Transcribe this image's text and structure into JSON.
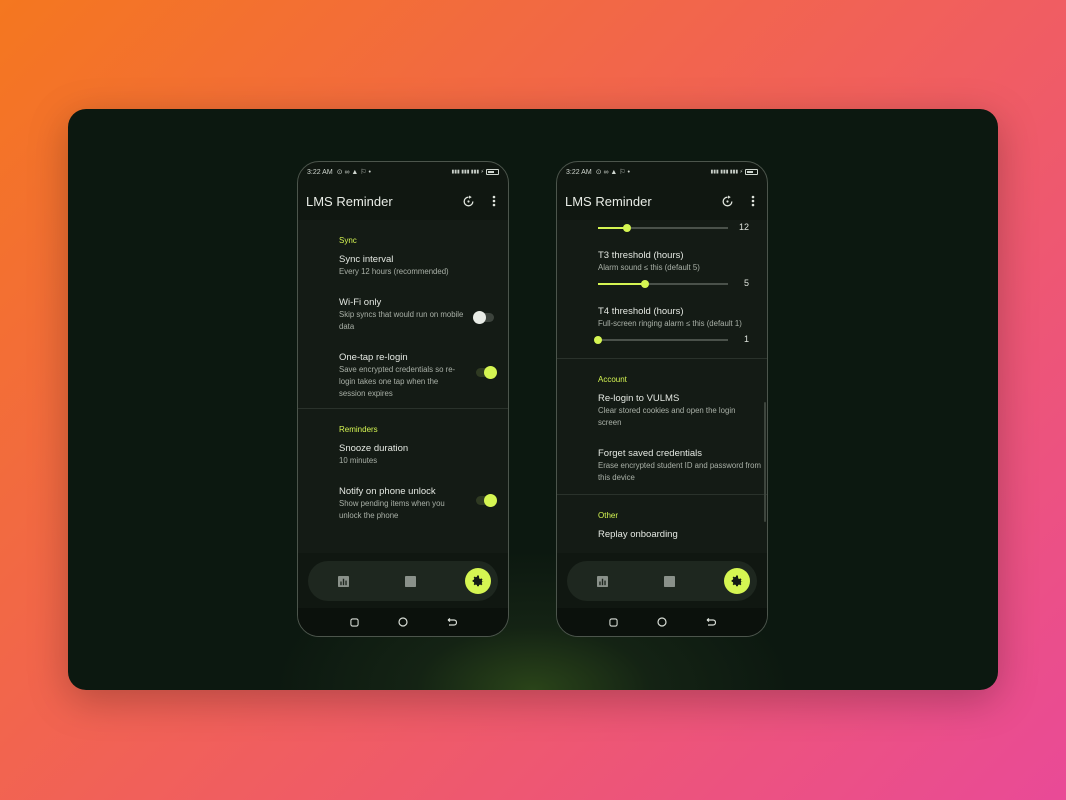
{
  "app_title": "LMS Reminder",
  "status": {
    "time": "3:22 AM",
    "battery": "80"
  },
  "colors": {
    "accent": "#d5f552",
    "surface": "#141b15",
    "nav_bg": "#1e271f"
  },
  "phone1": {
    "sections": [
      {
        "header": "Sync",
        "items": [
          {
            "title": "Sync interval",
            "subtitle": "Every 12 hours (recommended)"
          },
          {
            "title": "Wi-Fi only",
            "subtitle": "Skip syncs that would run on mobile data",
            "toggle": "off"
          },
          {
            "title": "One-tap re-login",
            "subtitle": "Save encrypted credentials so re-login takes one tap when the session expires",
            "toggle": "on"
          }
        ]
      },
      {
        "header": "Reminders",
        "items": [
          {
            "title": "Snooze duration",
            "subtitle": "10 minutes"
          },
          {
            "title": "Notify on phone unlock",
            "subtitle": "Show pending items when you unlock the phone",
            "toggle": "on"
          }
        ]
      }
    ]
  },
  "phone2": {
    "top_slider": {
      "value": "12",
      "fraction": 0.22
    },
    "thresholds": [
      {
        "title": "T3 threshold (hours)",
        "subtitle": "Alarm sound ≤ this (default 5)",
        "value": "5",
        "fraction": 0.36
      },
      {
        "title": "T4 threshold (hours)",
        "subtitle": "Full-screen ringing alarm ≤ this (default 1)",
        "value": "1",
        "fraction": 0.0
      }
    ],
    "sections": [
      {
        "header": "Account",
        "items": [
          {
            "title": "Re-login to VULMS",
            "subtitle": "Clear stored cookies and open the login screen"
          },
          {
            "title": "Forget saved credentials",
            "subtitle": "Erase encrypted student ID and password from this device"
          }
        ]
      },
      {
        "header": "Other",
        "items": [
          {
            "title": "Replay onboarding"
          }
        ]
      }
    ]
  },
  "nav": {
    "items": [
      {
        "icon": "bar-chart-icon"
      },
      {
        "icon": "square-icon"
      },
      {
        "icon": "gear-icon",
        "active": true
      }
    ]
  }
}
